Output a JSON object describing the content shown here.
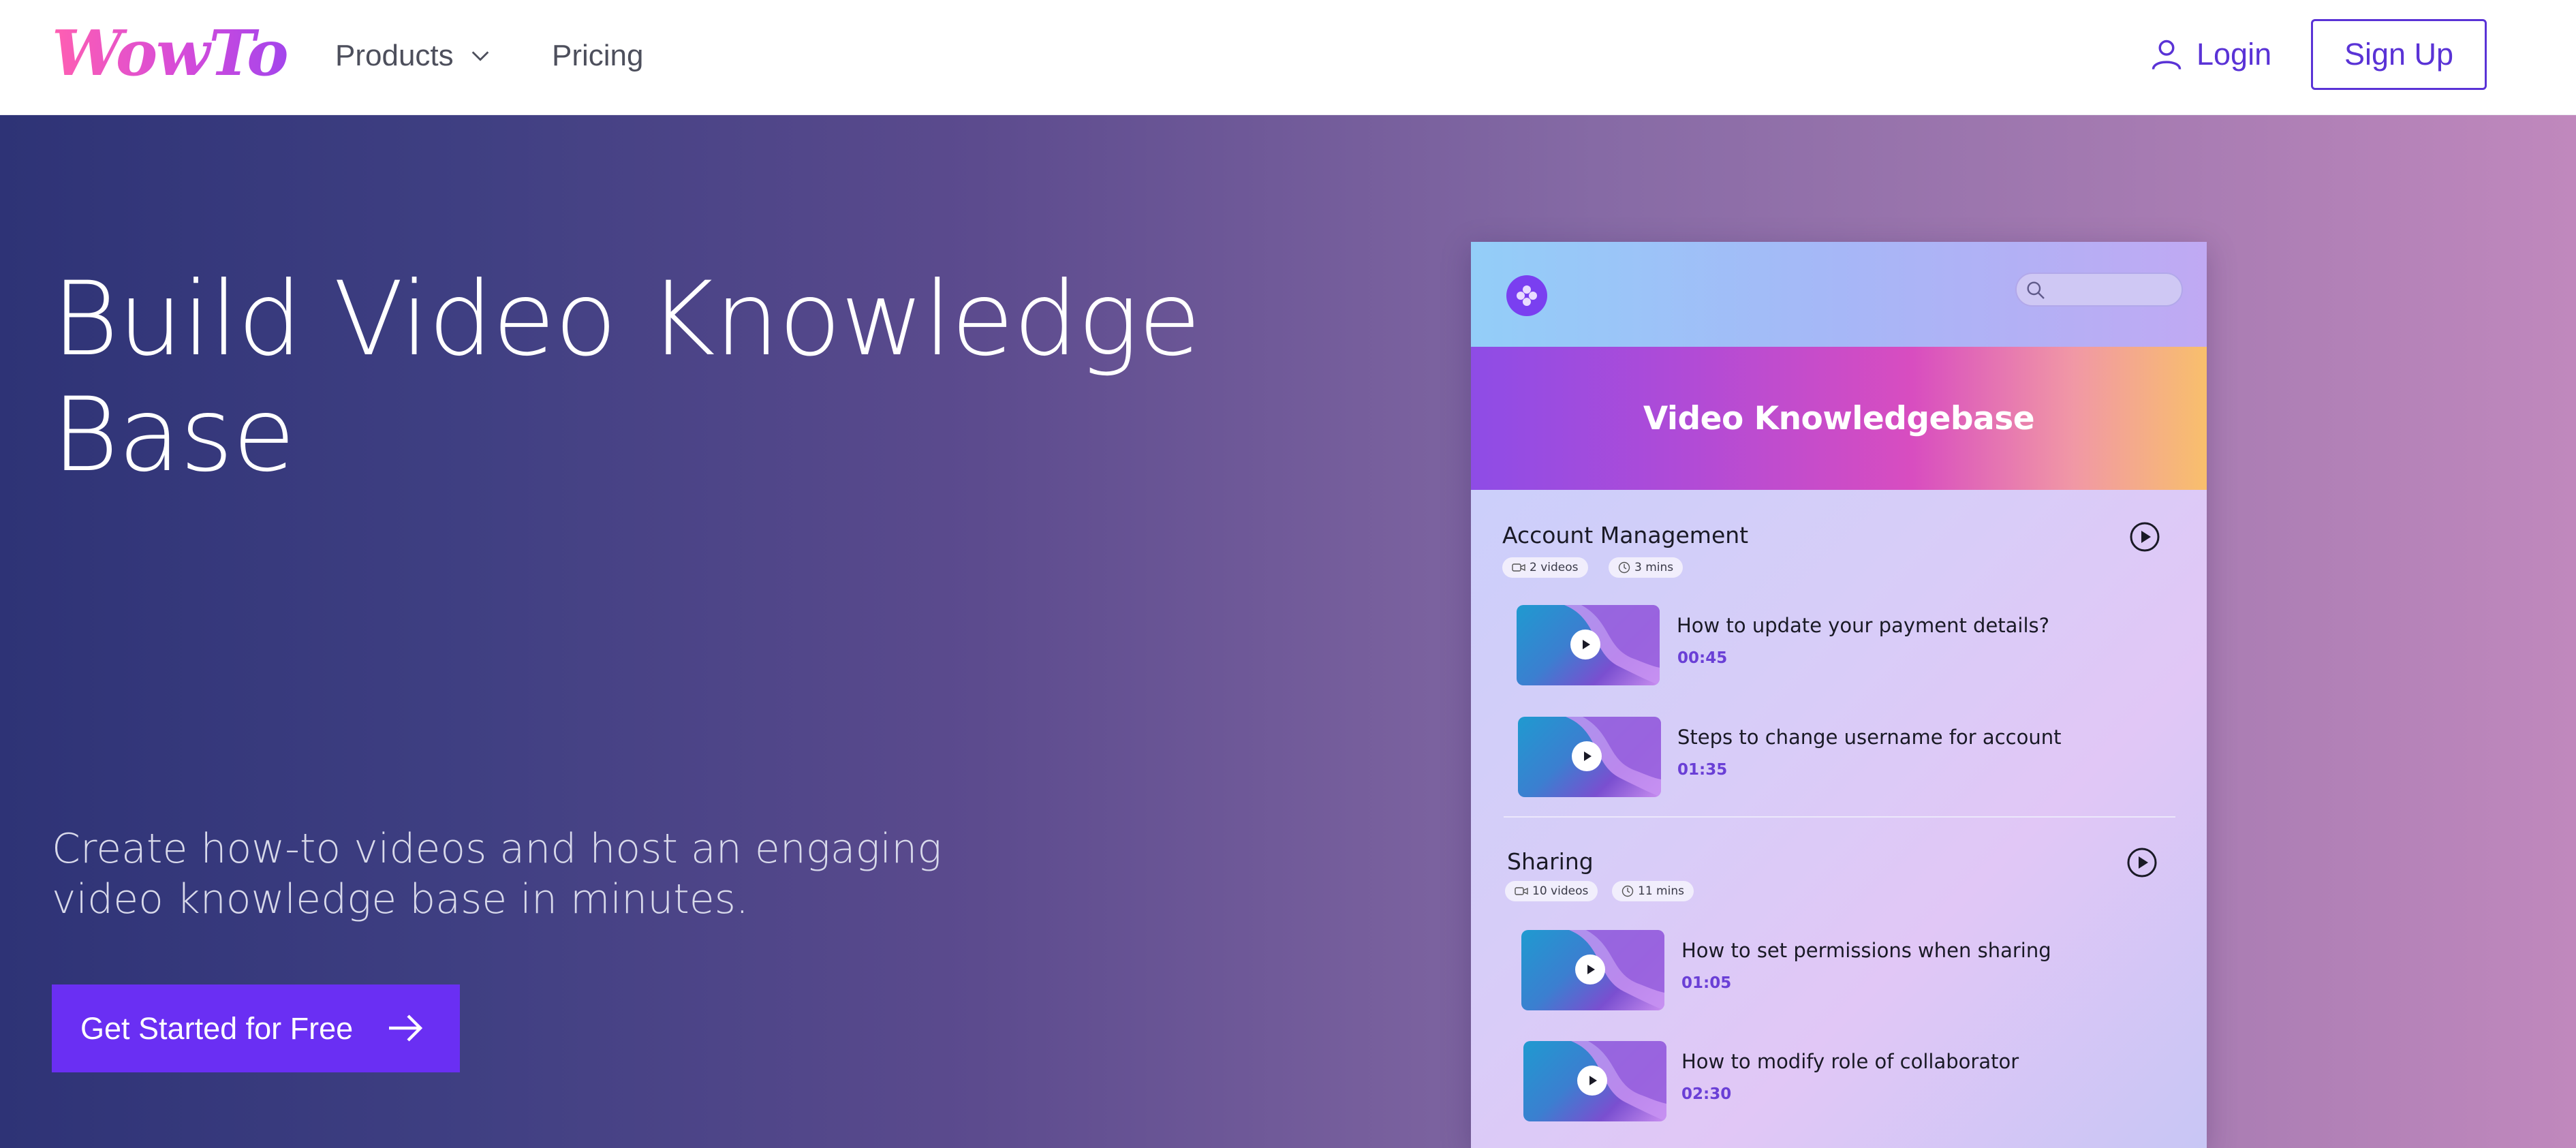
{
  "brand": {
    "logo_text": "WowTo"
  },
  "nav": {
    "products_label": "Products",
    "pricing_label": "Pricing",
    "login_label": "Login",
    "signup_label": "Sign Up"
  },
  "hero": {
    "title": "Build Video Knowledge Base",
    "subtitle": "Create how-to videos and host an engaging video knowledge base in minutes.",
    "cta_label": "Get Started for Free"
  },
  "preview": {
    "banner_title": "Video Knowledgebase",
    "sections": [
      {
        "title": "Account Management",
        "videos_count": "2 videos",
        "duration": "3 mins",
        "videos": [
          {
            "title": "How to update your payment details?",
            "duration": "00:45"
          },
          {
            "title": "Steps to change username for account",
            "duration": "01:35"
          }
        ]
      },
      {
        "title": "Sharing",
        "videos_count": "10 videos",
        "duration": "11 mins",
        "videos": [
          {
            "title": "How to set permissions when sharing",
            "duration": "01:05"
          },
          {
            "title": "How to modify role of collaborator",
            "duration": "02:30"
          }
        ]
      }
    ]
  },
  "colors": {
    "accent": "#5a33d6",
    "cta_bg": "#6a2ff3",
    "hero_gradient_start": "#2e3376",
    "hero_gradient_end": "#c088bd"
  },
  "icons": [
    "chevron-down-icon",
    "user-icon",
    "arrow-right-icon",
    "search-icon",
    "play-icon",
    "video-icon",
    "clock-icon"
  ]
}
